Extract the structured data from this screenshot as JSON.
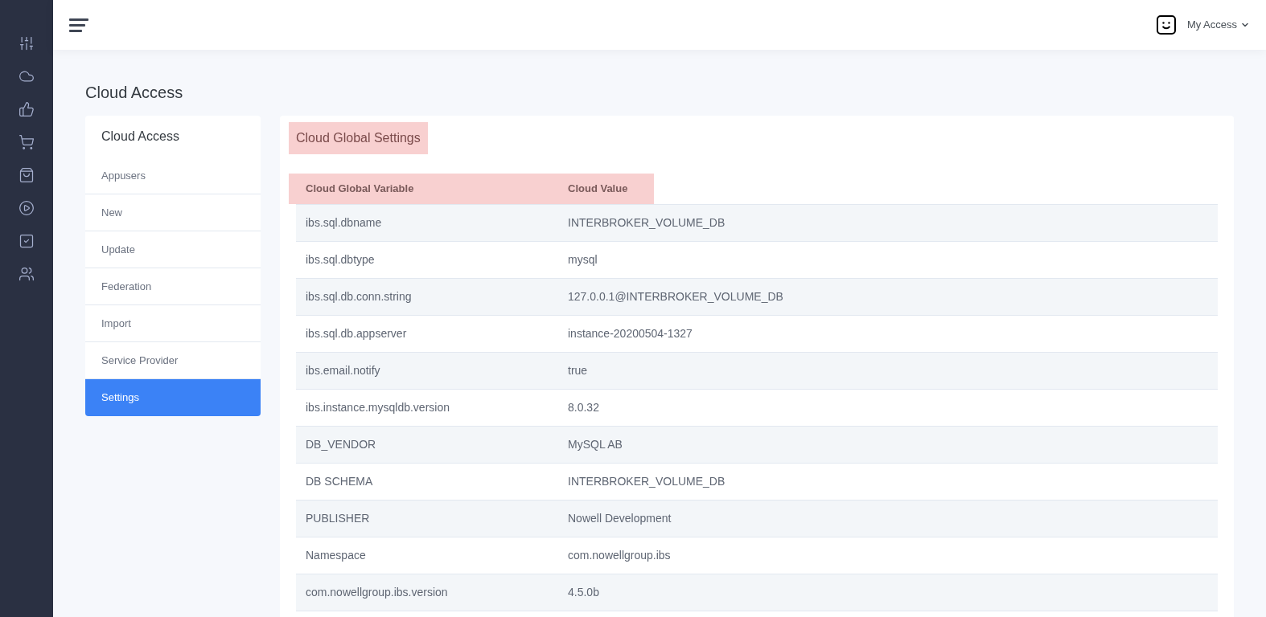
{
  "header": {
    "user_menu": "My Access"
  },
  "page_title": "Cloud Access",
  "side_menu": {
    "title": "Cloud Access",
    "items": [
      {
        "label": "Appusers",
        "selected": false
      },
      {
        "label": "New",
        "selected": false
      },
      {
        "label": "Update",
        "selected": false
      },
      {
        "label": "Federation",
        "selected": false
      },
      {
        "label": "Import",
        "selected": false
      },
      {
        "label": "Service Provider",
        "selected": false
      },
      {
        "label": "Settings",
        "selected": true
      }
    ]
  },
  "panel": {
    "title": "Cloud Global Settings",
    "table": {
      "columns": [
        "Cloud Global Variable",
        "Cloud Value"
      ],
      "rows": [
        [
          "ibs.sql.dbname",
          "INTERBROKER_VOLUME_DB"
        ],
        [
          "ibs.sql.dbtype",
          "mysql"
        ],
        [
          "ibs.sql.db.conn.string",
          "127.0.0.1@INTERBROKER_VOLUME_DB"
        ],
        [
          "ibs.sql.db.appserver",
          "instance-20200504-1327"
        ],
        [
          "ibs.email.notify",
          "true"
        ],
        [
          "ibs.instance.mysqldb.version",
          "8.0.32"
        ],
        [
          "DB_VENDOR",
          "MySQL AB"
        ],
        [
          "DB SCHEMA",
          "INTERBROKER_VOLUME_DB"
        ],
        [
          "PUBLISHER",
          "Nowell Development"
        ],
        [
          "Namespace",
          "com.nowellgroup.ibs"
        ],
        [
          "com.nowellgroup.ibs.version",
          "4.5.0b"
        ]
      ]
    }
  }
}
